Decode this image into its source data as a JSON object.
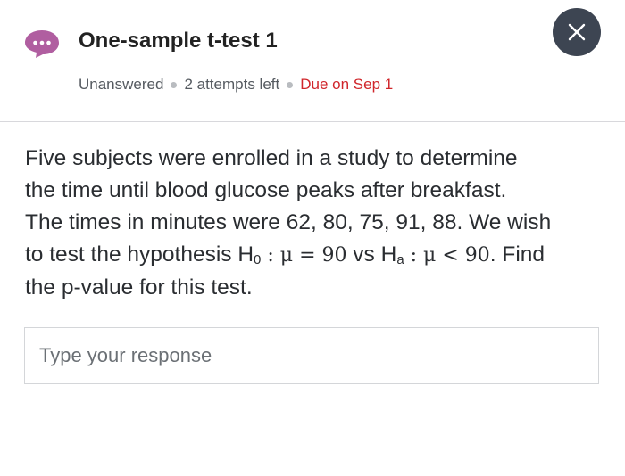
{
  "header": {
    "title": "One-sample t-test 1",
    "status": "Unanswered",
    "attempts": "2 attempts left",
    "due": "Due on Sep 1",
    "icon_color": "#b05ea0",
    "close_icon": "close-icon"
  },
  "question": {
    "line1": "Five subjects were enrolled in a study to determine",
    "line2": "the time until blood glucose peaks after breakfast.",
    "line3": "The times in minutes were 62, 80, 75, 91, 88. We wish",
    "line4_a": "to test the hypothesis H",
    "h0_sub": "0",
    "h0_expr": " : μ = 90",
    "vs": " vs H",
    "ha_sub": "a",
    "ha_expr": " : μ < 90",
    "line4_end": ". Find",
    "line5": "the p-value for this test."
  },
  "response": {
    "placeholder": "Type your response",
    "value": ""
  }
}
